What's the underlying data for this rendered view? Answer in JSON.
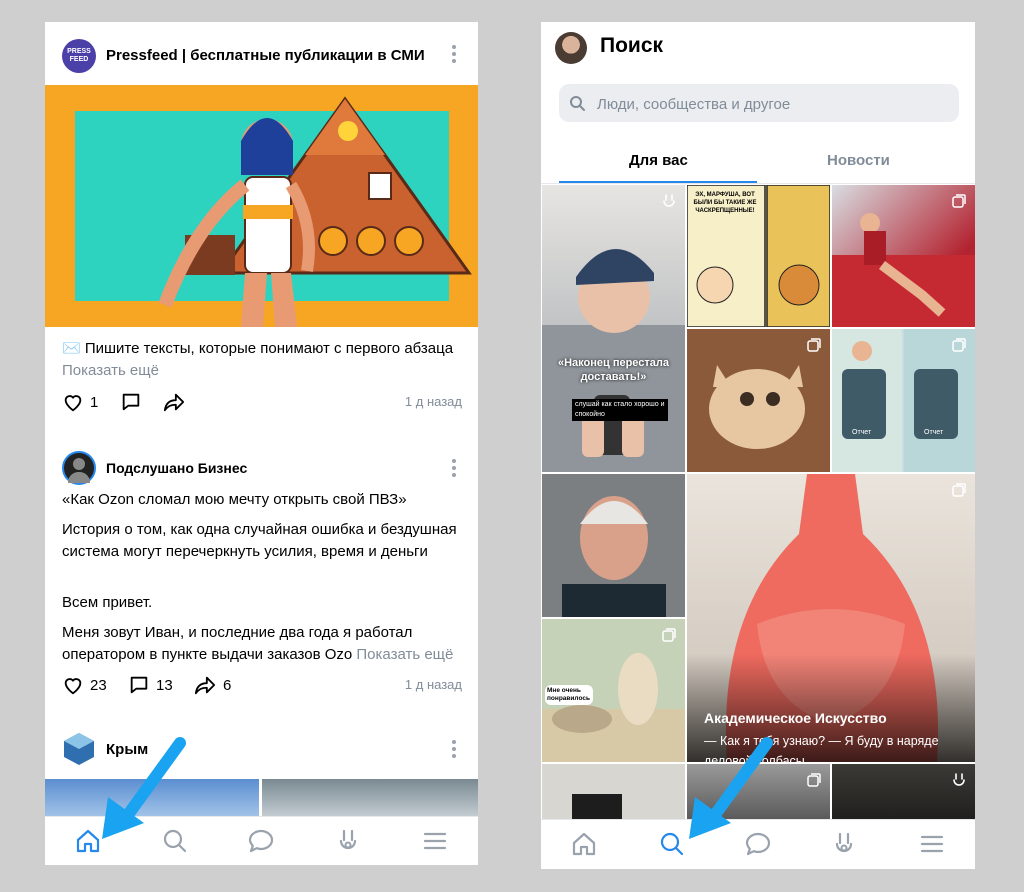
{
  "left_screen": {
    "posts": [
      {
        "author": "Pressfeed | бесплатные публикации в СМИ",
        "avatar_text": "PRESS FEED",
        "text": "✉️ Пишите тексты, которые понимают с первого абзаца",
        "more": "Показать ещё",
        "likes": "1",
        "time": "1 д назад"
      },
      {
        "author": "Подслушано Бизнес",
        "title_line": "«Как Ozon сломал мою мечту открыть свой ПВЗ»",
        "paragraph1": "История о том, как одна случайная ошибка и бездушная система могут перечеркнуть усилия, время и деньги",
        "paragraph2": "Всем привет.",
        "paragraph3": "Меня зовут Иван, и последние два года я работал оператором в пункте выдачи заказов Ozo",
        "more": "Показать ещё",
        "likes": "23",
        "comments": "13",
        "shares": "6",
        "time": "1 д назад"
      },
      {
        "author": "Крым"
      }
    ]
  },
  "right_screen": {
    "title": "Поиск",
    "search_placeholder": "Люди, сообщества и другое",
    "tabs": [
      "Для вас",
      "Новости"
    ],
    "tiles": {
      "woman_caption": "«Наконец перестала доставать!»",
      "woman_subcaption": "слушай как стало хорошо и спокойно",
      "comic_text": "ЭХ, МАРФУША, ВОТ БЫЛИ БЫ ТАКИЕ ЖЕ ЧАСКРЕПЩЕННЫЕ!",
      "painting_caption": "Мне очень понравилось",
      "featured_title": "Академическое Искусство",
      "featured_text": "— Как я тебя узнаю? — Я буду в наряде деловой колбасы",
      "phone_label_1": "Отчет",
      "phone_label_2": "Отчет"
    }
  },
  "colors": {
    "accent": "#2688eb",
    "arrow": "#1aa3f0",
    "muted": "#818c99",
    "orange_bg": "#f6a623",
    "teal_bg": "#2ed3c0"
  }
}
